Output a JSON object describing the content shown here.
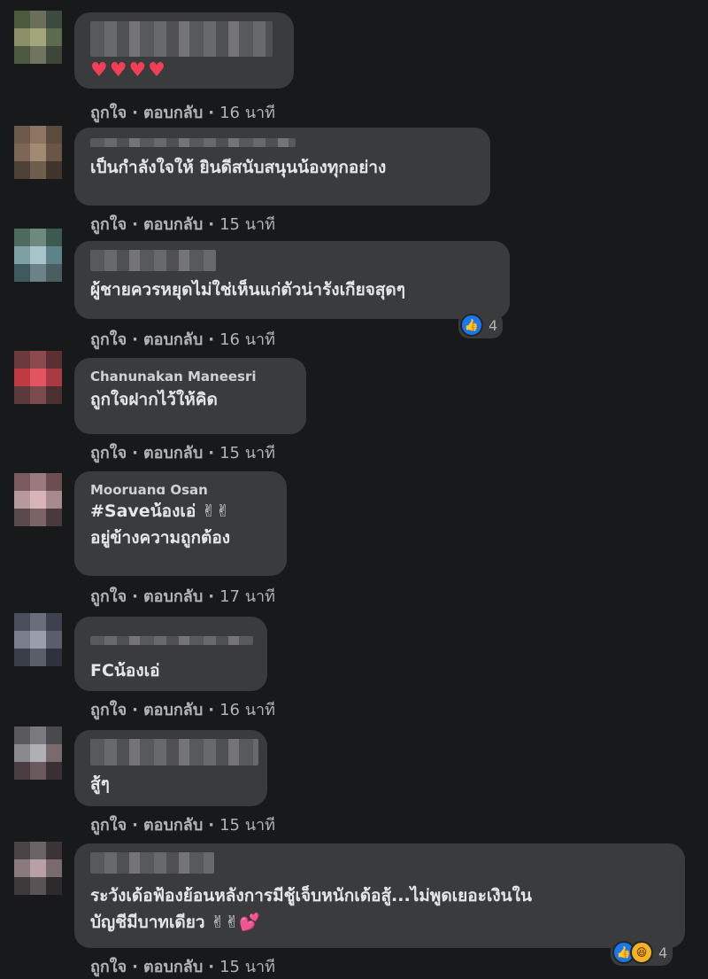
{
  "actions": {
    "like": "ถูกใจ",
    "reply": "ตอบกลับ",
    "separator": "·"
  },
  "comments": [
    {
      "name": "",
      "lines": [
        "♥♥♥♥"
      ],
      "time": "16 นาที"
    },
    {
      "name": "",
      "lines": [
        "เป็นกำลังใจให้ ยินดีสนับสนุนน้องทุกอย่าง"
      ],
      "time": "15 นาที"
    },
    {
      "name": "",
      "lines": [
        "ผู้ชายควรหยุดไม่ใช่เห็นแก่ตัวน่ารังเกียจสุดๆ"
      ],
      "time": "16 นาที",
      "reaction_count": "4"
    },
    {
      "name": "Chanunakan Maneesri",
      "lines": [
        "ถูกใจฝากไว้ให้คิด"
      ],
      "time": "15 นาที"
    },
    {
      "name": "Mooruang Osan",
      "lines": [
        "#Saveน้องเอ่ ✌✌",
        "อยู่ข้างความถูกต้อง"
      ],
      "time": "17 นาที"
    },
    {
      "name": "",
      "lines": [
        "FCน้องเอ่"
      ],
      "time": "16 นาที"
    },
    {
      "name": "",
      "lines": [
        "สู้ๆ"
      ],
      "time": "15 นาที"
    },
    {
      "name": "",
      "lines": [
        "ระวังเด้อฟ้องย้อนหลังการมีชู้เจ็บหนักเด้อสู้...ไม่พูดเยอะเงินใน",
        "บัญชีมีบาทเดียว ✌✌💕"
      ],
      "time": "15 นาที",
      "reaction_count": "4"
    }
  ],
  "icons": {
    "like": "like-icon",
    "haha": "haha-icon"
  },
  "colors": {
    "background": "#18191a",
    "bubble": "#3a3b3c",
    "text": "#e4e6eb",
    "meta": "#b0b3b8",
    "like": "#1877f2"
  }
}
